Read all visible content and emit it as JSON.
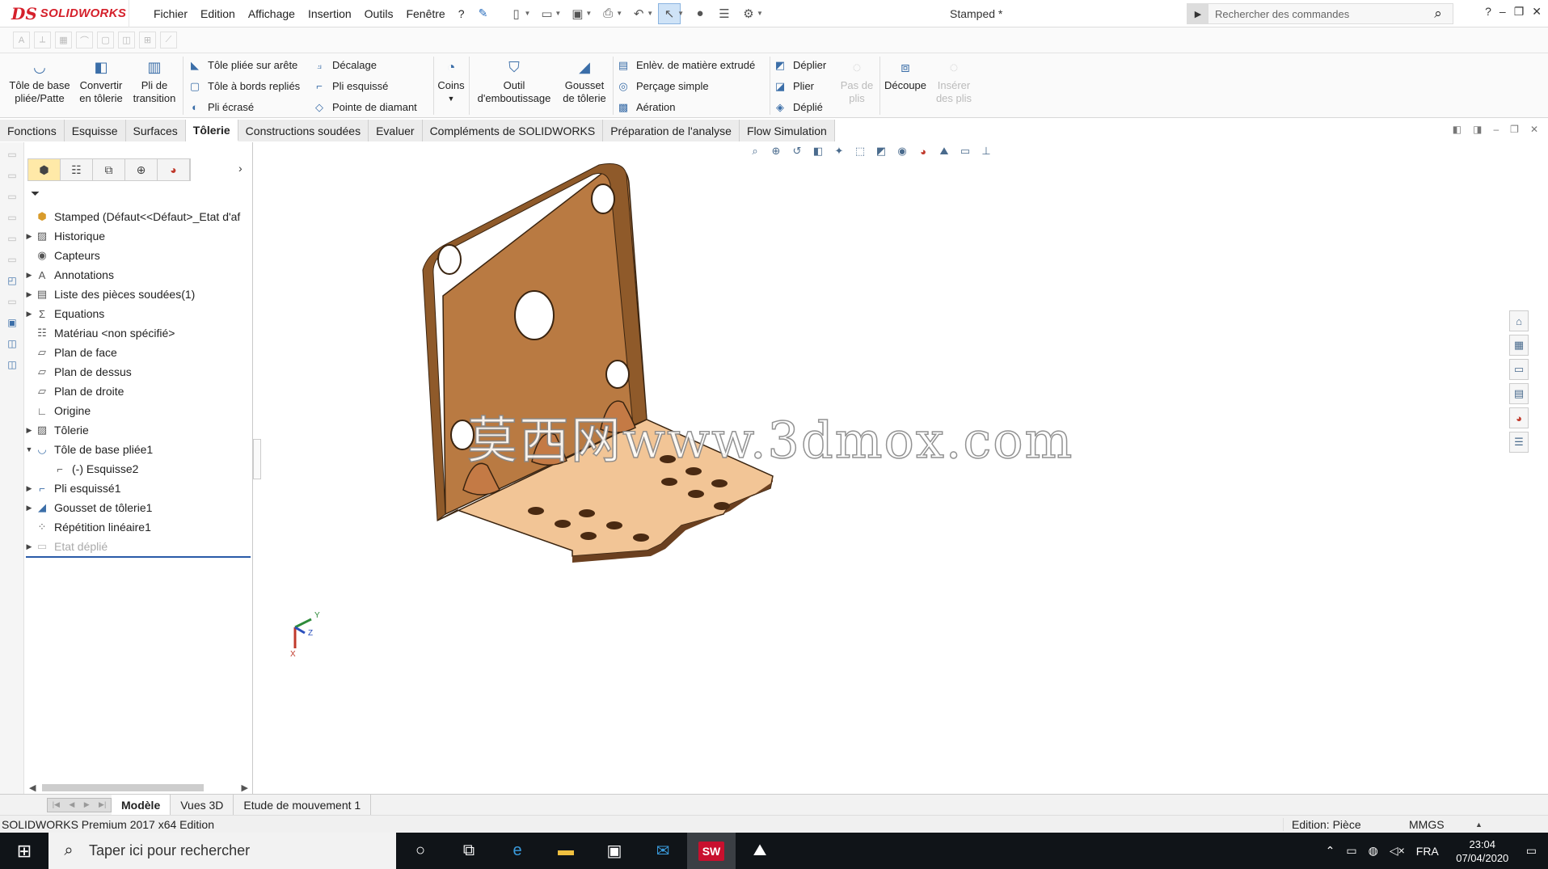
{
  "titlebar": {
    "logo_ds": "DS",
    "logo_text": "SOLIDWORKS",
    "menu": [
      "Fichier",
      "Edition",
      "Affichage",
      "Insertion",
      "Outils",
      "Fenêtre",
      "?"
    ],
    "document_title": "Stamped *",
    "search_placeholder": "Rechercher des commandes",
    "help": "?"
  },
  "ribbon": {
    "tole_de_base": "Tôle de base pliée/Patte",
    "convertir": "Convertir en tôlerie",
    "pli_transition": "Pli de transition",
    "tole_pliee_arete": "Tôle pliée sur arête",
    "tole_bords_replies": "Tôle à bords repliés",
    "pli_ecrase": "Pli écrasé",
    "decalage": "Décalage",
    "pli_esquisse": "Pli esquissé",
    "pointe_diamant": "Pointe de diamant",
    "coins": "Coins",
    "outil_emboutissage": "Outil d'emboutissage",
    "gousset": "Gousset de tôlerie",
    "enlev_matiere": "Enlèv. de matière extrudé",
    "percage": "Perçage simple",
    "aeration": "Aération",
    "deplier": "Déplier",
    "plier": "Plier",
    "deplie": "Déplié",
    "pas_de_plis": "Pas de plis",
    "decoupe": "Découpe",
    "inserer_plis": "Insérer des plis"
  },
  "tabs": [
    "Fonctions",
    "Esquisse",
    "Surfaces",
    "Tôlerie",
    "Constructions soudées",
    "Evaluer",
    "Compléments de SOLIDWORKS",
    "Préparation de l'analyse",
    "Flow Simulation"
  ],
  "tree": {
    "root": "Stamped  (Défaut<<Défaut>_Etat d'af",
    "nodes": [
      "Historique",
      "Capteurs",
      "Annotations",
      "Liste des pièces soudées(1)",
      "Equations",
      "Matériau <non spécifié>",
      "Plan de face",
      "Plan de dessus",
      "Plan de droite",
      "Origine",
      "Tôlerie",
      "Tôle de base pliée1",
      "(-) Esquisse2",
      "Pli esquissé1",
      "Gousset de tôlerie1",
      "Répétition linéaire1",
      "Etat déplié"
    ]
  },
  "graphics": {
    "watermark": "莫西网www.3dmox.com",
    "triad_x": "X",
    "triad_y": "Y",
    "triad_z": "Z",
    "part_color": "#b8783f"
  },
  "bottom_tabs": [
    "Modèle",
    "Vues 3D",
    "Etude de mouvement 1"
  ],
  "status": {
    "edition": "SOLIDWORKS Premium 2017 x64 Edition",
    "mode": "Edition: Pièce",
    "units": "MMGS"
  },
  "taskbar": {
    "search_placeholder": "Taper ici pour rechercher",
    "sw_label": "SW",
    "language": "FRA",
    "time": "23:04",
    "date": "07/04/2020"
  }
}
